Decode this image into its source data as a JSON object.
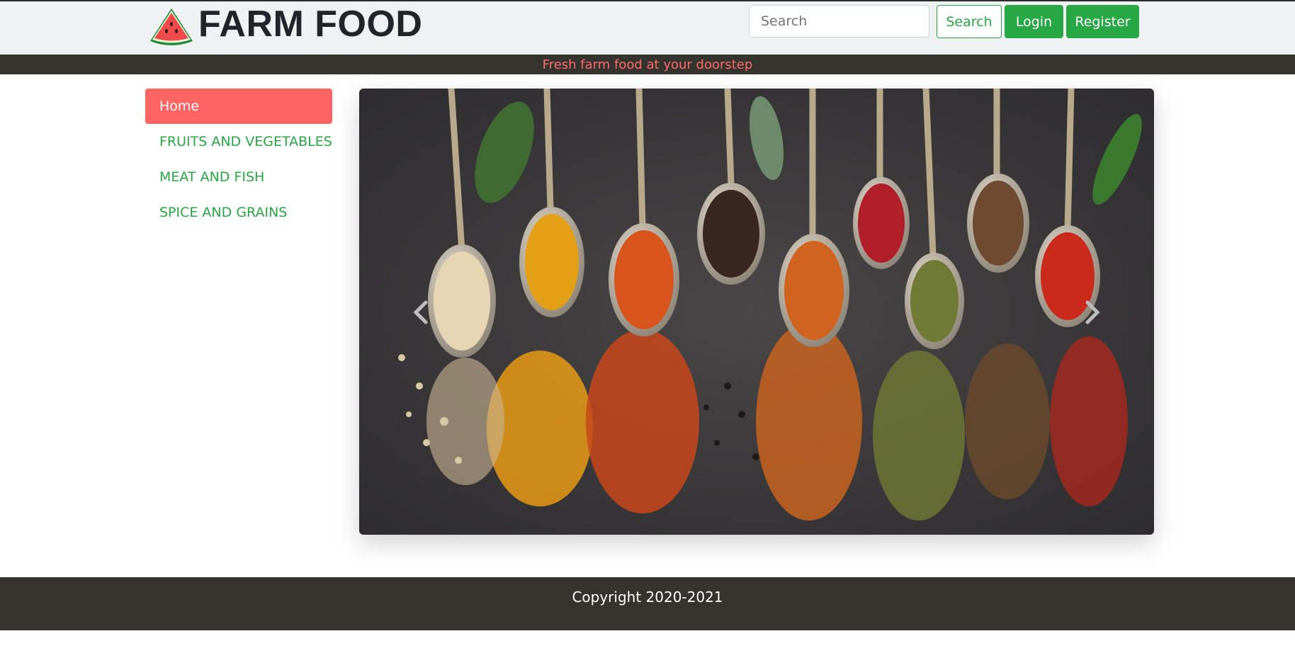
{
  "header": {
    "brand": "FARM FOOD",
    "logo_icon": "watermelon-slice-icon",
    "search": {
      "placeholder": "Search",
      "value": ""
    },
    "search_button": "Search",
    "login_button": "Login",
    "register_button": "Register"
  },
  "tagline": "Fresh farm food at your doorstep",
  "sidebar": {
    "items": [
      {
        "label": "Home",
        "active": true
      },
      {
        "label": "FRUITS AND VEGETABLES",
        "active": false
      },
      {
        "label": "MEAT AND FISH",
        "active": false
      },
      {
        "label": "SPICE AND GRAINS",
        "active": false
      }
    ]
  },
  "carousel": {
    "prev_icon": "chevron-left-icon",
    "next_icon": "chevron-right-icon"
  },
  "footer": {
    "copyright": "Copyright 2020-2021"
  },
  "colors": {
    "primary_green": "#28a745",
    "active_red": "#ff6464",
    "tagline_pink": "#ff6b6b",
    "dark_band": "#35332e"
  }
}
